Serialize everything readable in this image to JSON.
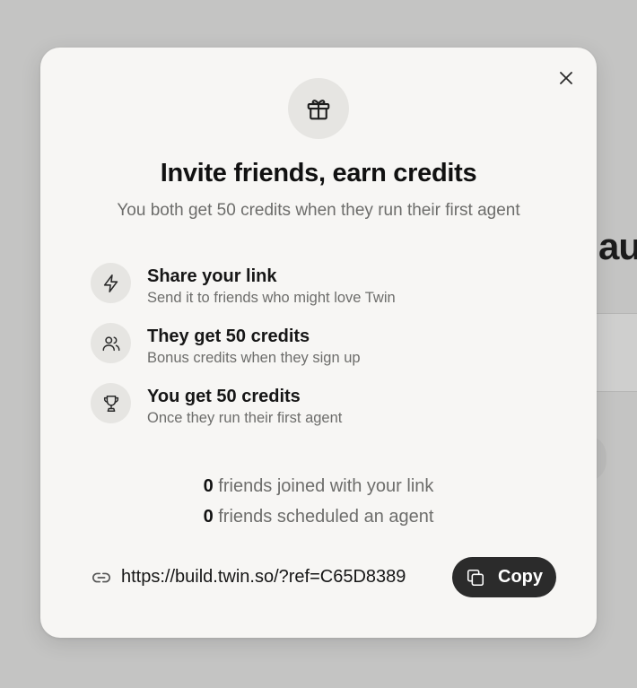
{
  "background": {
    "partial_heading": "au"
  },
  "modal": {
    "title": "Invite friends, earn credits",
    "subtitle": "You both get 50 credits when they run their first agent",
    "steps": [
      {
        "icon": "lightning-icon",
        "title": "Share your link",
        "description": "Send it to friends who might love Twin"
      },
      {
        "icon": "users-icon",
        "title": "They get 50 credits",
        "description": "Bonus credits when they sign up"
      },
      {
        "icon": "trophy-icon",
        "title": "You get 50 credits",
        "description": "Once they run their first agent"
      }
    ],
    "stats": [
      {
        "count": "0",
        "label": "friends joined with your link"
      },
      {
        "count": "0",
        "label": "friends scheduled an agent"
      }
    ],
    "referral_link": "https://build.twin.so/?ref=C65D8389",
    "copy_label": "Copy"
  },
  "colors": {
    "overlay": "#c4c4c3",
    "modal_bg": "#f7f6f4",
    "icon_circle": "#e6e5e2",
    "copy_button": "#2b2b2b",
    "muted_text": "#6d6d6b"
  }
}
